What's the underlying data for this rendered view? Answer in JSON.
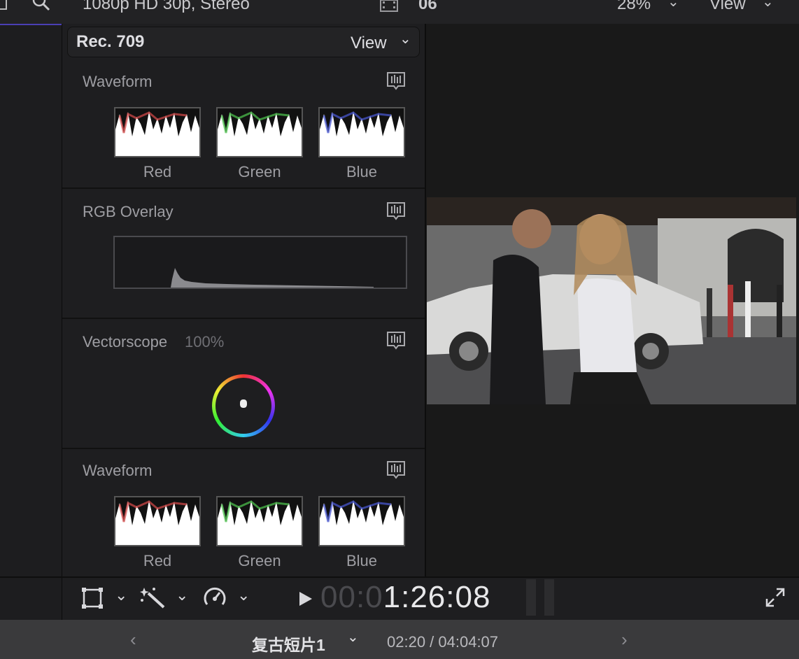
{
  "topbar": {
    "format": "1080p HD 30p, Stereo",
    "clip_number": "06",
    "zoom": "28%",
    "view_label": "View"
  },
  "scopes": {
    "colorspace": "Rec. 709",
    "view_label": "View",
    "sections": [
      {
        "title": "Waveform",
        "channels": [
          "Red",
          "Green",
          "Blue"
        ]
      },
      {
        "title": "RGB Overlay"
      },
      {
        "title": "Vectorscope",
        "sub": "100%"
      },
      {
        "title": "Waveform",
        "channels": [
          "Red",
          "Green",
          "Blue"
        ]
      }
    ]
  },
  "controls": {
    "timecode_dim": "00:0",
    "timecode": "1:26:08"
  },
  "bottombar": {
    "project_title": "复古短片1",
    "playhead": "02:20 / 04:04:07"
  },
  "colors": {
    "accent": "#4a3fb5",
    "red_channel": "#d94a4a",
    "green_channel": "#4ec84e",
    "blue_channel": "#4a5ad9"
  },
  "icons": [
    "search-icon",
    "film-icon",
    "chevron-down-icon",
    "scope-settings-icon",
    "transform-icon",
    "magic-wand-icon",
    "speed-icon",
    "play-icon",
    "fullscreen-icon",
    "chevron-left-icon",
    "chevron-right-icon"
  ]
}
